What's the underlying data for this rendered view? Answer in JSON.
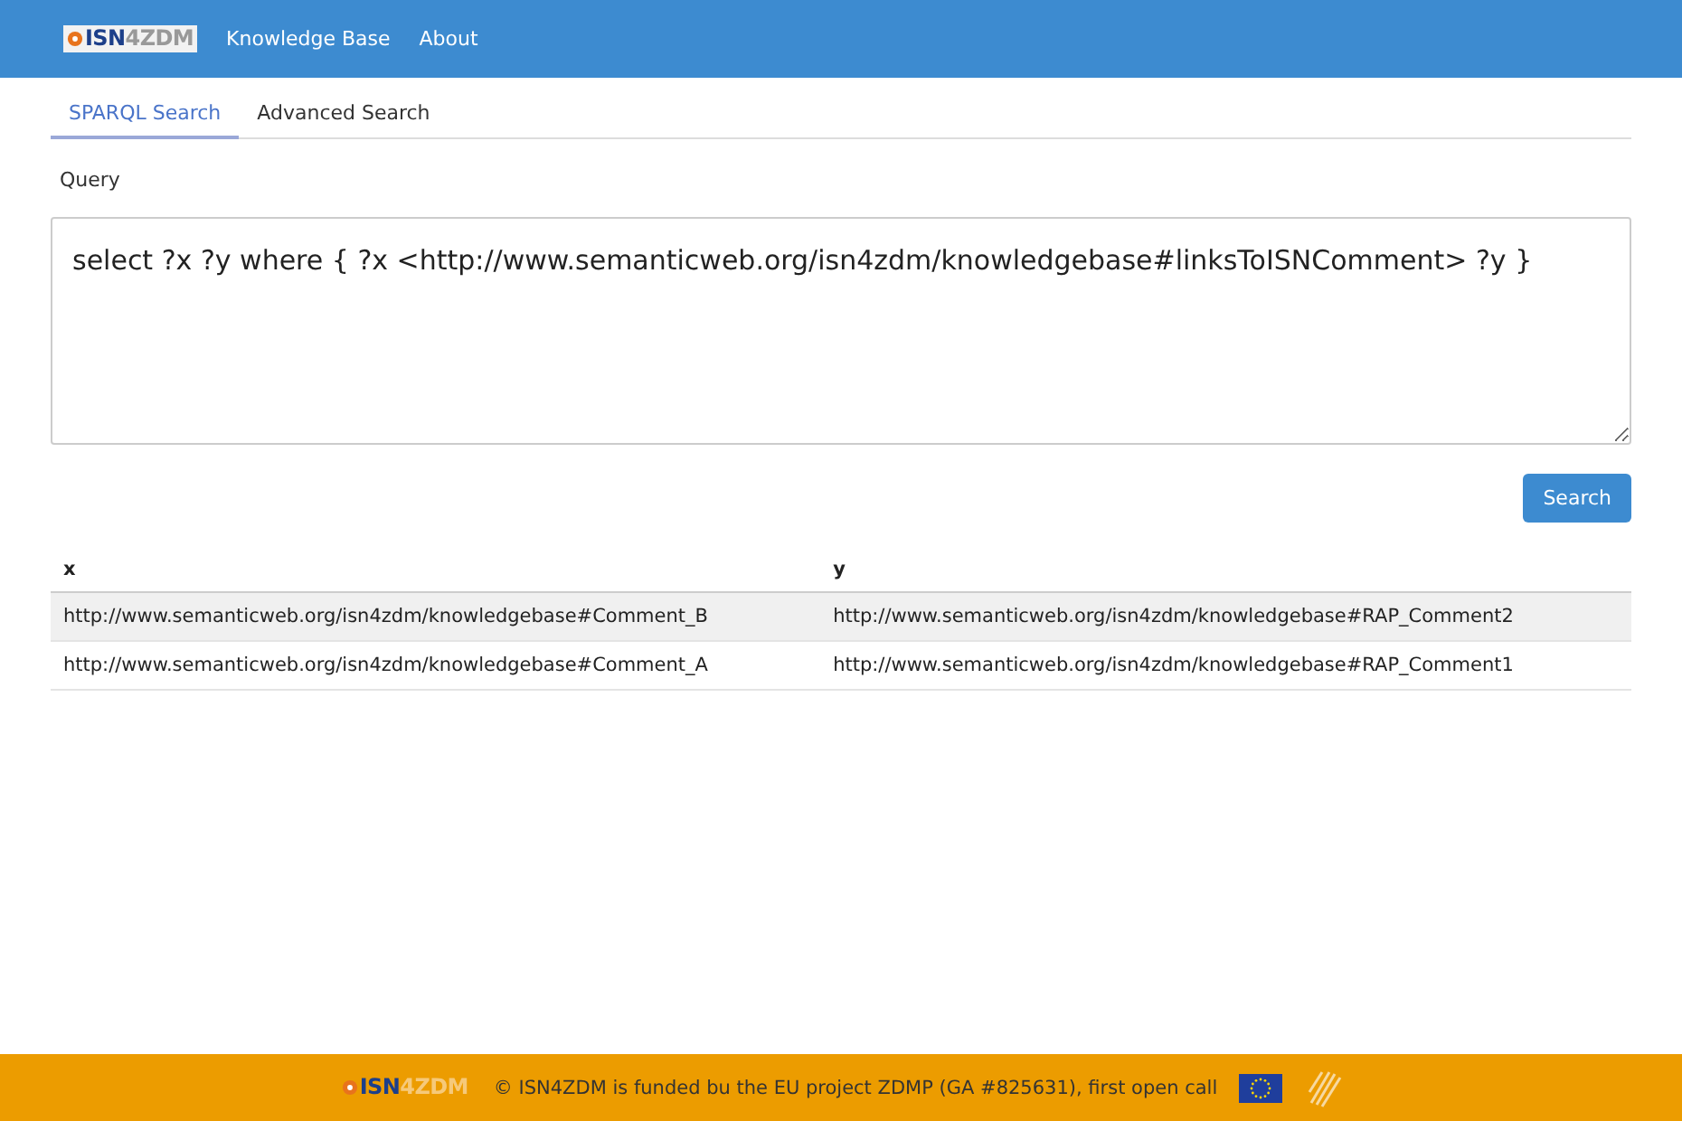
{
  "navbar": {
    "logo": {
      "part_1": "ISN",
      "part_2": "4ZDM"
    },
    "links": [
      "Knowledge Base",
      "About"
    ]
  },
  "tabs": [
    {
      "label": "SPARQL Search",
      "selected": true
    },
    {
      "label": "Advanced Search",
      "selected": false
    }
  ],
  "query": {
    "label": "Query",
    "value": "select ?x ?y where { ?x <http://www.semanticweb.org/isn4zdm/knowledgebase#linksToISNComment> ?y }"
  },
  "search_button": "Search",
  "table": {
    "columns": [
      "x",
      "y"
    ],
    "rows": [
      {
        "cells": [
          "http://www.semanticweb.org/isn4zdm/knowledgebase#Comment_B",
          "http://www.semanticweb.org/isn4zdm/knowledgebase#RAP_Comment2"
        ]
      },
      {
        "cells": [
          "http://www.semanticweb.org/isn4zdm/knowledgebase#Comment_A",
          "http://www.semanticweb.org/isn4zdm/knowledgebase#RAP_Comment1"
        ]
      }
    ]
  },
  "footer": {
    "logo": {
      "part_1": "ISN",
      "part_2": "4ZDM"
    },
    "text": "© ISN4ZDM is funded bu the EU project ZDMP (GA #825631), first open call"
  }
}
